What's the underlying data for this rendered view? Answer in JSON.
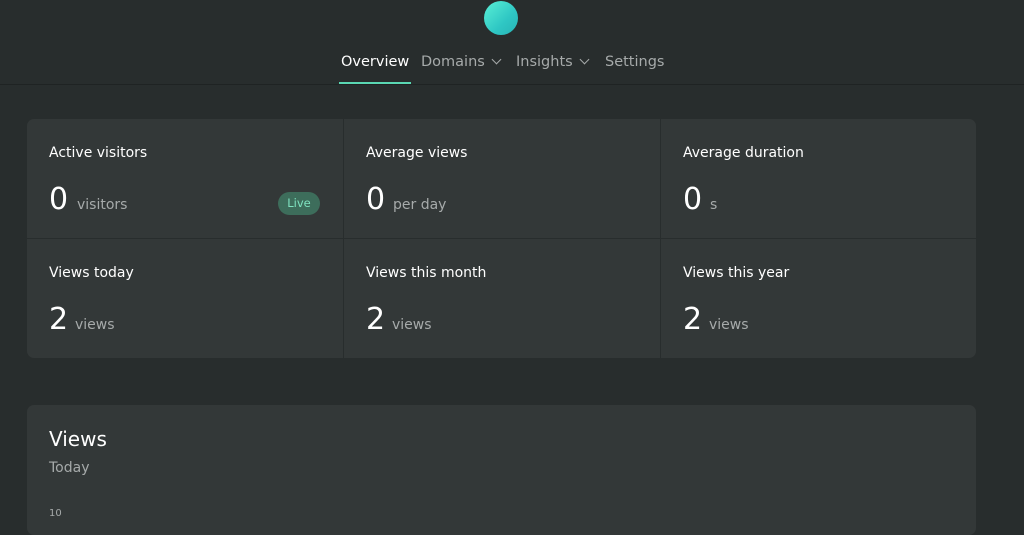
{
  "nav": {
    "items": [
      {
        "label": "Overview",
        "active": true,
        "dropdown": false
      },
      {
        "label": "Domains",
        "active": false,
        "dropdown": true
      },
      {
        "label": "Insights",
        "active": false,
        "dropdown": true
      },
      {
        "label": "Settings",
        "active": false,
        "dropdown": false
      }
    ]
  },
  "stats": [
    {
      "title": "Active visitors",
      "value": "0",
      "unit": "visitors",
      "badge": "Live"
    },
    {
      "title": "Average views",
      "value": "0",
      "unit": "per day"
    },
    {
      "title": "Average duration",
      "value": "0",
      "unit": "s"
    },
    {
      "title": "Views today",
      "value": "2",
      "unit": "views"
    },
    {
      "title": "Views this month",
      "value": "2",
      "unit": "views"
    },
    {
      "title": "Views this year",
      "value": "2",
      "unit": "views"
    }
  ],
  "views_chart": {
    "title": "Views",
    "subtitle": "Today",
    "first_tick": "10"
  },
  "colors": {
    "background": "#282d2d",
    "card": "#333838",
    "accent": "#5ad7b3",
    "badge_bg": "#3d6d5b",
    "badge_text": "#7fe3c0",
    "muted_text": "#a6aaaa"
  }
}
